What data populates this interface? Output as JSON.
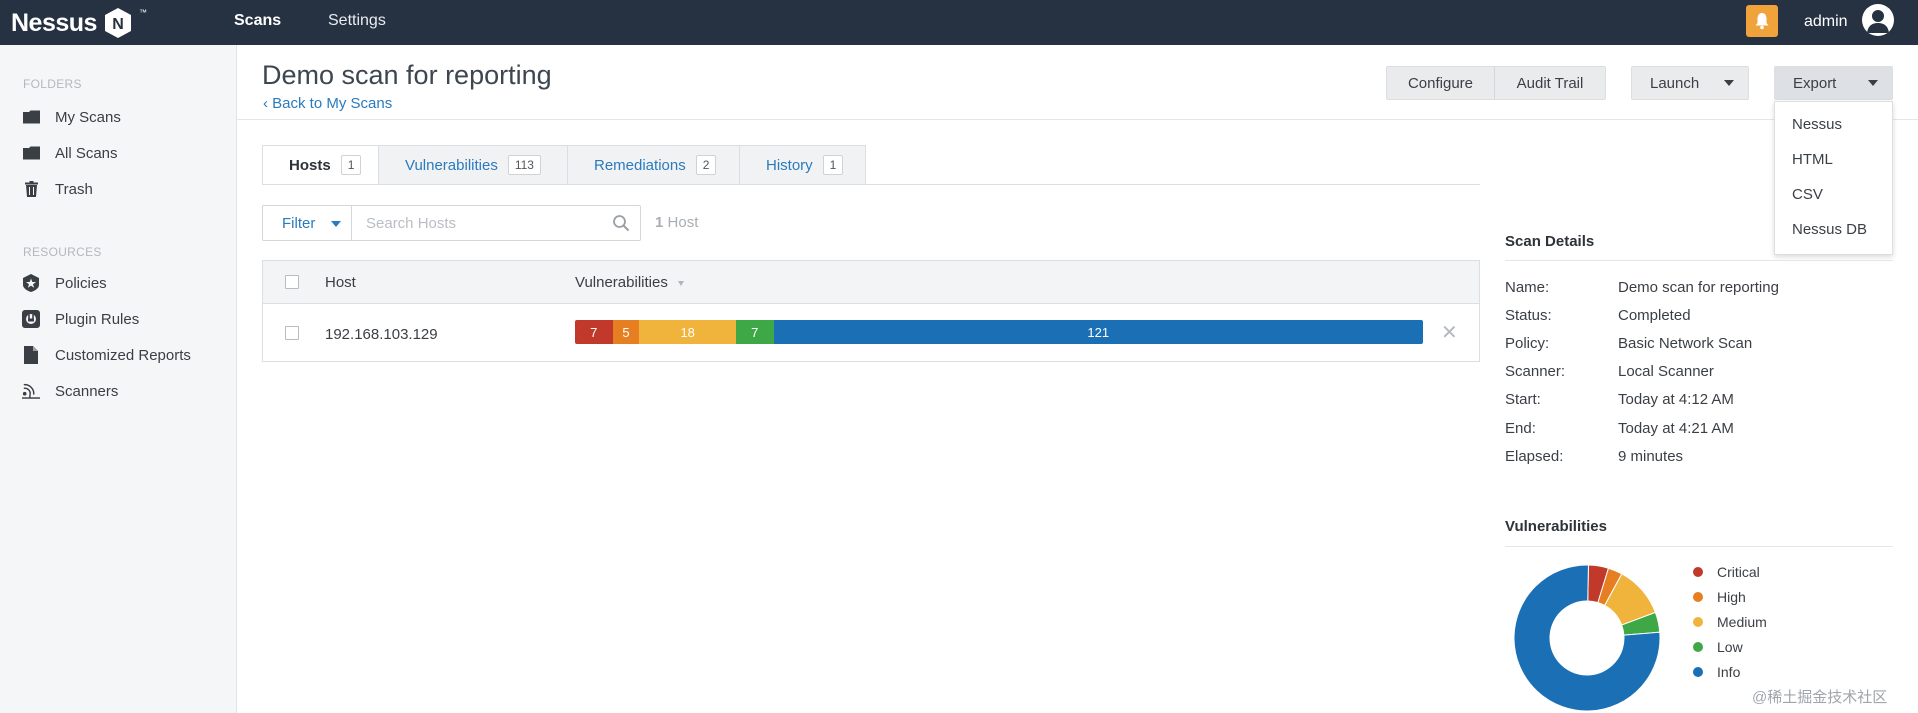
{
  "app": {
    "logo": "Nessus",
    "logo_mark": "N",
    "trademark": "™",
    "nav": {
      "scans": "Scans",
      "settings": "Settings"
    },
    "user": "admin"
  },
  "sidebar": {
    "folders_heading": "FOLDERS",
    "folders": [
      {
        "label": "My Scans",
        "icon": "folder-icon"
      },
      {
        "label": "All Scans",
        "icon": "folder-icon"
      },
      {
        "label": "Trash",
        "icon": "trash-icon"
      }
    ],
    "resources_heading": "RESOURCES",
    "resources": [
      {
        "label": "Policies",
        "icon": "policy-star-icon"
      },
      {
        "label": "Plugin Rules",
        "icon": "plugin-icon"
      },
      {
        "label": "Customized Reports",
        "icon": "document-icon"
      },
      {
        "label": "Scanners",
        "icon": "scanner-icon"
      }
    ]
  },
  "header": {
    "title": "Demo scan for reporting",
    "back": "‹ Back to My Scans",
    "buttons": {
      "configure": "Configure",
      "audit_trail": "Audit Trail",
      "launch": "Launch",
      "export": "Export"
    },
    "export_menu": [
      "Nessus",
      "HTML",
      "CSV",
      "Nessus DB"
    ]
  },
  "tabs": [
    {
      "label": "Hosts",
      "count": "1",
      "active": true
    },
    {
      "label": "Vulnerabilities",
      "count": "113",
      "active": false
    },
    {
      "label": "Remediations",
      "count": "2",
      "active": false
    },
    {
      "label": "History",
      "count": "1",
      "active": false
    }
  ],
  "filter": {
    "button": "Filter",
    "search_placeholder": "Search Hosts",
    "count_number": "1",
    "count_label": "Host"
  },
  "table": {
    "columns": {
      "host": "Host",
      "vulnerabilities": "Vulnerabilities"
    },
    "rows": [
      {
        "host": "192.168.103.129",
        "segments": [
          {
            "severity": "critical",
            "label": "7",
            "value": 7
          },
          {
            "severity": "high",
            "label": "5",
            "value": 5
          },
          {
            "severity": "medium",
            "label": "18",
            "value": 18
          },
          {
            "severity": "low",
            "label": "7",
            "value": 7
          },
          {
            "severity": "info",
            "label": "121",
            "value": 121
          }
        ]
      }
    ]
  },
  "scan_details": {
    "title": "Scan Details",
    "fields": [
      {
        "label": "Name:",
        "value": "Demo scan for reporting"
      },
      {
        "label": "Status:",
        "value": "Completed"
      },
      {
        "label": "Policy:",
        "value": "Basic Network Scan"
      },
      {
        "label": "Scanner:",
        "value": "Local Scanner"
      },
      {
        "label": "Start:",
        "value": "Today at 4:12 AM"
      },
      {
        "label": "End:",
        "value": "Today at 4:21 AM"
      },
      {
        "label": "Elapsed:",
        "value": "9 minutes"
      }
    ]
  },
  "vulnerabilities_panel": {
    "title": "Vulnerabilities",
    "legend": [
      {
        "label": "Critical",
        "color": "#c0392b",
        "value": 7
      },
      {
        "label": "High",
        "color": "#e67e22",
        "value": 5
      },
      {
        "label": "Medium",
        "color": "#f0b43c",
        "value": 18
      },
      {
        "label": "Low",
        "color": "#3fa846",
        "value": 7
      },
      {
        "label": "Info",
        "color": "#1a6fb5",
        "value": 121
      }
    ]
  },
  "colors": {
    "critical": "#c0392b",
    "high": "#e67e22",
    "medium": "#f0b43c",
    "low": "#3fa846",
    "info": "#1a6fb5",
    "topbar": "#263241",
    "link": "#2a7bbd"
  },
  "watermark": "@稀土掘金技术社区"
}
